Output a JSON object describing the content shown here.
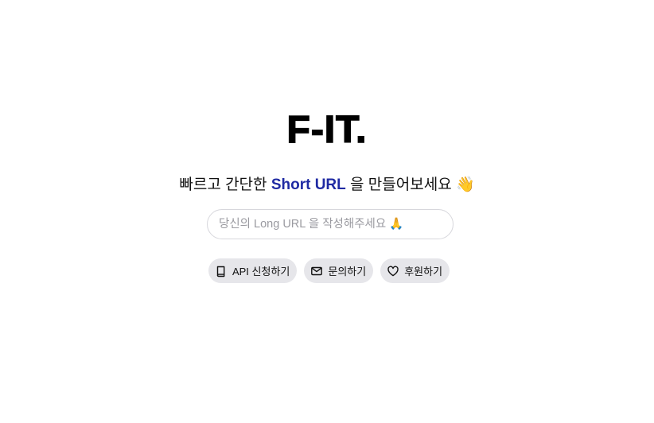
{
  "logo": {
    "text": "F-IT."
  },
  "tagline": {
    "prefix": "빠르고 간단한",
    "highlight": "Short URL",
    "suffix": "을 만들어보세요",
    "emoji": "👋"
  },
  "url_input": {
    "placeholder": "당신의 Long URL 을 작성해주세요 🙏",
    "value": ""
  },
  "actions": [
    {
      "label": "API 신청하기",
      "icon": "book-icon"
    },
    {
      "label": "문의하기",
      "icon": "mail-icon"
    },
    {
      "label": "후원하기",
      "icon": "heart-icon"
    }
  ],
  "colors": {
    "accent": "#1f2aa3",
    "pill_bg": "#e6e6ea",
    "input_border": "#d7d7dc",
    "placeholder": "#9a9aa0"
  }
}
